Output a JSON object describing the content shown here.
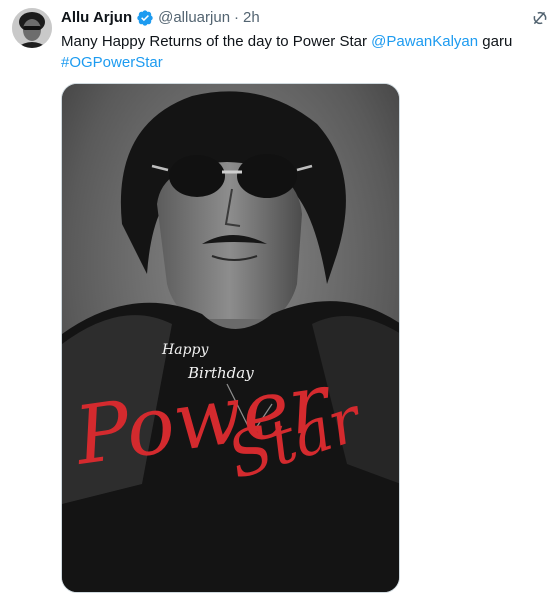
{
  "tweet": {
    "author_name": "Allu Arjun",
    "verified_icon": "verified-badge-icon",
    "handle": "@alluarjun",
    "separator": "·",
    "time": "2h",
    "text_before": "Many Happy Returns of the day to Power Star ",
    "mention": "@PawanKalyan",
    "text_after": " garu",
    "hashtag": "#OGPowerStar",
    "grok_icon": "grok-icon",
    "colors": {
      "link": "#1d9bf0",
      "verified": "#1d9bf0",
      "muted": "#536471"
    }
  },
  "poster": {
    "greeting_line1": "Happy",
    "greeting_line2": "Birthday",
    "title_word1": "Power",
    "title_word2": "Star",
    "accent_color": "#d42a2e"
  }
}
